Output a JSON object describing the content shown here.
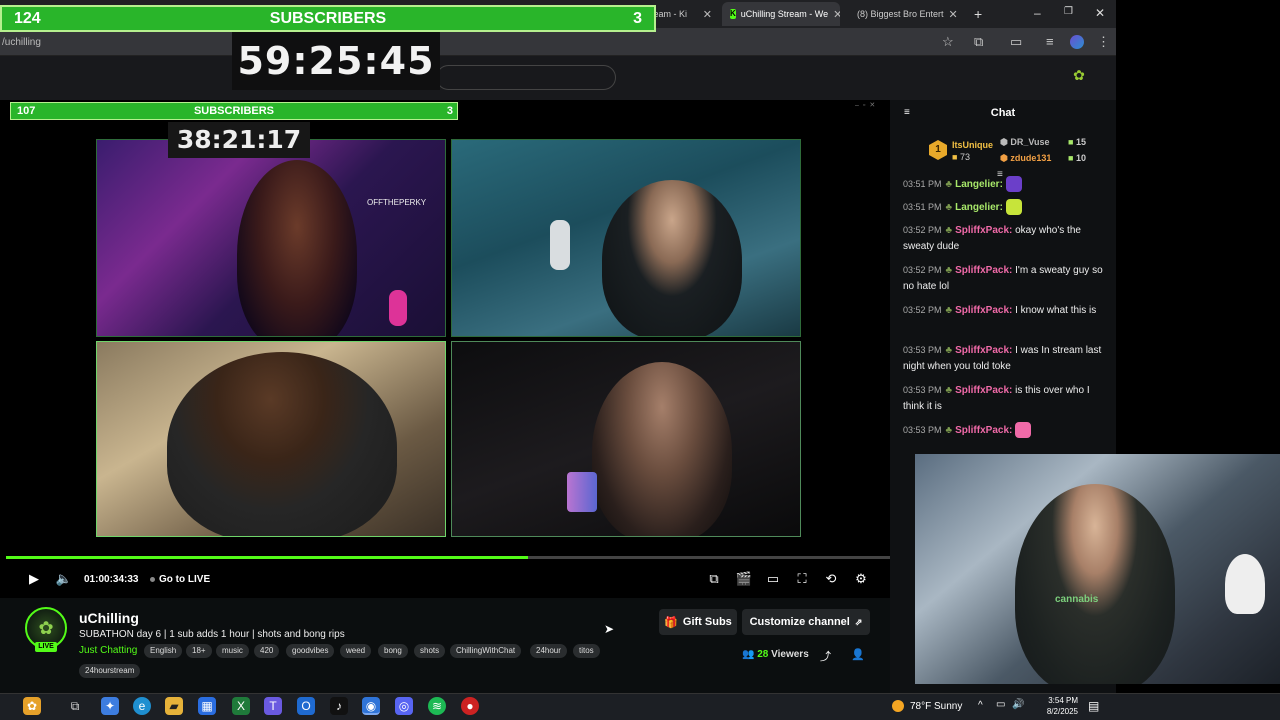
{
  "browser": {
    "tabs": [
      {
        "label": "tream - Ki"
      },
      {
        "label": "uChilling Stream - We"
      },
      {
        "label": "(8) Biggest Bro Entert"
      }
    ],
    "new_tab_symbol": "+",
    "url": "/uchilling",
    "window_controls": {
      "minimize": "–",
      "restore": "❐",
      "close": "✕"
    }
  },
  "overlay_top": {
    "left_count": "124",
    "title": "SUBSCRIBERS",
    "right_count": "3",
    "timer": "59:25:45"
  },
  "overlay_inner": {
    "left_count": "107",
    "title": "SUBSCRIBERS",
    "right_count": "3",
    "timer": "38:21:17"
  },
  "player": {
    "time": "01:00:34:33",
    "go_live": "Go to LIVE",
    "progress": 0.59
  },
  "channel": {
    "name": "uChilling",
    "live_badge": "LIVE",
    "title": "SUBATHON day 6 | 1 sub adds 1 hour | shots and bong rips",
    "category": "Just Chatting",
    "tags": [
      "English",
      "18+",
      "music",
      "420",
      "goodvibes",
      "weed",
      "bong",
      "shots",
      "ChillingWithChat",
      "24hour",
      "titos",
      "24hourstream"
    ],
    "gift_subs": "Gift Subs",
    "customize": "Customize channel",
    "viewers_count": "28",
    "viewers_label": "Viewers"
  },
  "chat": {
    "title": "Chat",
    "leaderboard": {
      "first_rank": "1",
      "first_user": "ItsUnique",
      "first_score": "73",
      "second_user": "DR_Vuse",
      "second_score": "15",
      "third_user": "zdude131",
      "third_score": "10"
    },
    "messages": [
      {
        "time": "03:51 PM",
        "user": "Langelier",
        "text": "",
        "user_color": "#a8e86a"
      },
      {
        "time": "03:51 PM",
        "user": "Langelier",
        "text": "",
        "user_color": "#a8e86a"
      },
      {
        "time": "03:52 PM",
        "user": "SpliffxPack",
        "text": "okay who's the sweaty dude",
        "user_color": "#f06aa8"
      },
      {
        "time": "03:52 PM",
        "user": "SpliffxPack",
        "text": "I'm a sweaty guy so no hate lol",
        "user_color": "#f06aa8"
      },
      {
        "time": "03:52 PM",
        "user": "SpliffxPack",
        "text": "I know what this is",
        "user_color": "#f06aa8"
      },
      {
        "time": "03:53 PM",
        "user": "SpliffxPack",
        "text": "I was In stream last night when you told toke",
        "user_color": "#f06aa8"
      },
      {
        "time": "03:53 PM",
        "user": "SpliffxPack",
        "text": "is this over who I think it is",
        "user_color": "#f06aa8"
      },
      {
        "time": "03:53 PM",
        "user": "SpliffxPack",
        "text": "",
        "user_color": "#f06aa8"
      }
    ]
  },
  "taskbar": {
    "weather": "78°F  Sunny",
    "time": "3:54 PM",
    "date": "8/2/2025"
  },
  "colors": {
    "accent": "#53fc18",
    "sub_bar": "#29b52a"
  }
}
